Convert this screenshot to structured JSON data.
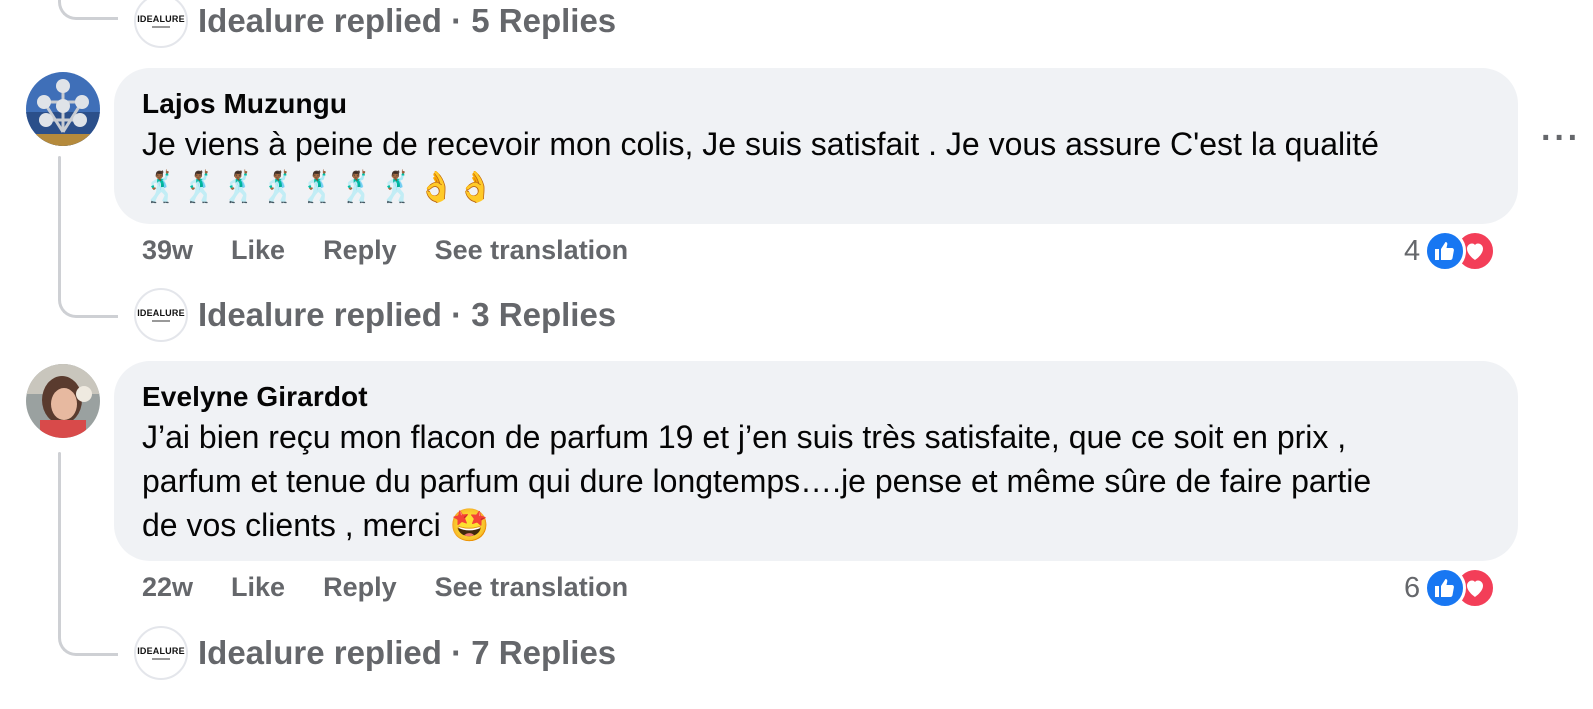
{
  "brand_avatar_text": "IDEALURE",
  "colors": {
    "bubble": "#f0f2f5",
    "secondary_text": "#65676b",
    "like_blue": "#1877f2",
    "love_red": "#f33e58",
    "thread_line": "#ced0d4"
  },
  "top_reply": {
    "label": "Idealure replied · 5 Replies"
  },
  "comments": [
    {
      "author": "Lajos Muzungu",
      "text": "Je viens à peine de recevoir mon colis, Je suis satisfait . Je vous assure C'est la qualité",
      "emoji_line": "🕺🏾🕺🏾🕺🏾🕺🏾🕺🏾🕺🏾🕺🏾👌👌",
      "time": "39w",
      "like_label": "Like",
      "reply_label": "Reply",
      "translate_label": "See translation",
      "reaction_count": "4",
      "reactions": [
        "like-icon",
        "love-icon"
      ],
      "reply_summary": "Idealure replied · 3 Replies",
      "more_icon": "more-options-icon"
    },
    {
      "author": "Evelyne Girardot",
      "text_line1": "J’ai bien reçu mon flacon de parfum 19 et j’en suis très satisfaite, que ce soit en prix ,",
      "text_line2": "parfum et tenue du parfum qui dure longtemps….je pense et même sûre de faire partie",
      "text_line3": "de vos clients , merci",
      "text_emoji": "🤩",
      "time": "22w",
      "like_label": "Like",
      "reply_label": "Reply",
      "translate_label": "See translation",
      "reaction_count": "6",
      "reactions": [
        "like-icon",
        "love-icon"
      ],
      "reply_summary": "Idealure replied · 7 Replies"
    }
  ]
}
